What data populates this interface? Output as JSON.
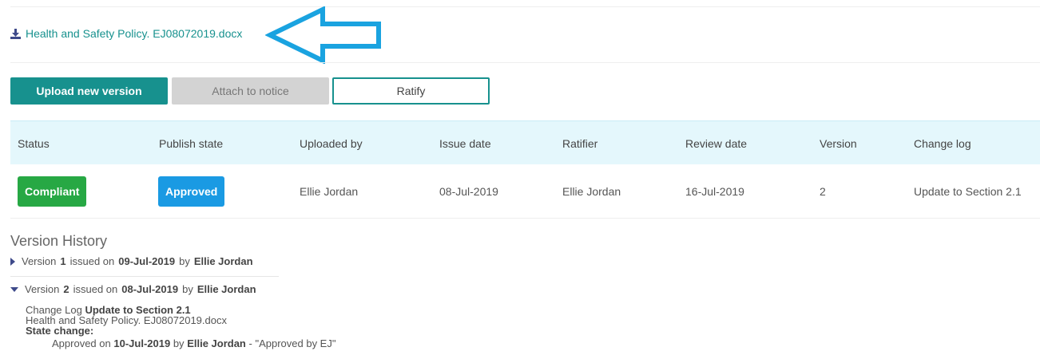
{
  "file": {
    "name": "Health and Safety Policy. EJ08072019.docx",
    "icon": "download-icon"
  },
  "toolbar": {
    "upload_label": "Upload new version",
    "attach_label": "Attach to notice",
    "ratify_label": "Ratify"
  },
  "table": {
    "headers": [
      "Status",
      "Publish state",
      "Uploaded by",
      "Issue date",
      "Ratifier",
      "Review date",
      "Version",
      "Change log"
    ],
    "row": {
      "status": "Compliant",
      "publish_state": "Approved",
      "uploaded_by": "Ellie Jordan",
      "issue_date": "08-Jul-2019",
      "ratifier": "Ellie Jordan",
      "review_date": "16-Jul-2019",
      "version": "2",
      "change_log": "Update to Section 2.1"
    }
  },
  "version_history": {
    "title": "Version History",
    "entries": [
      {
        "prefix": "Version",
        "number": "1",
        "issued_text": "issued on",
        "date": "09-Jul-2019",
        "by_text": "by",
        "author": "Ellie Jordan",
        "expanded": false
      },
      {
        "prefix": "Version",
        "number": "2",
        "issued_text": "issued on",
        "date": "08-Jul-2019",
        "by_text": "by",
        "author": "Ellie Jordan",
        "expanded": true,
        "change_log_label": "Change Log",
        "change_log_value": "Update to Section 2.1",
        "file_name": "Health and Safety Policy. EJ08072019.docx",
        "state_change_label": "State change:",
        "state_change": {
          "state": "Approved",
          "on_text": "on",
          "date": "10-Jul-2019",
          "by_text": "by",
          "author": "Ellie Jordan",
          "comment": "- \"Approved by EJ\""
        }
      }
    ]
  },
  "colors": {
    "accent": "#17918e",
    "compliant": "#27a844",
    "approved": "#1a9ae3",
    "arrow": "#1aa3e0",
    "header_bg": "#e4f7fc"
  }
}
